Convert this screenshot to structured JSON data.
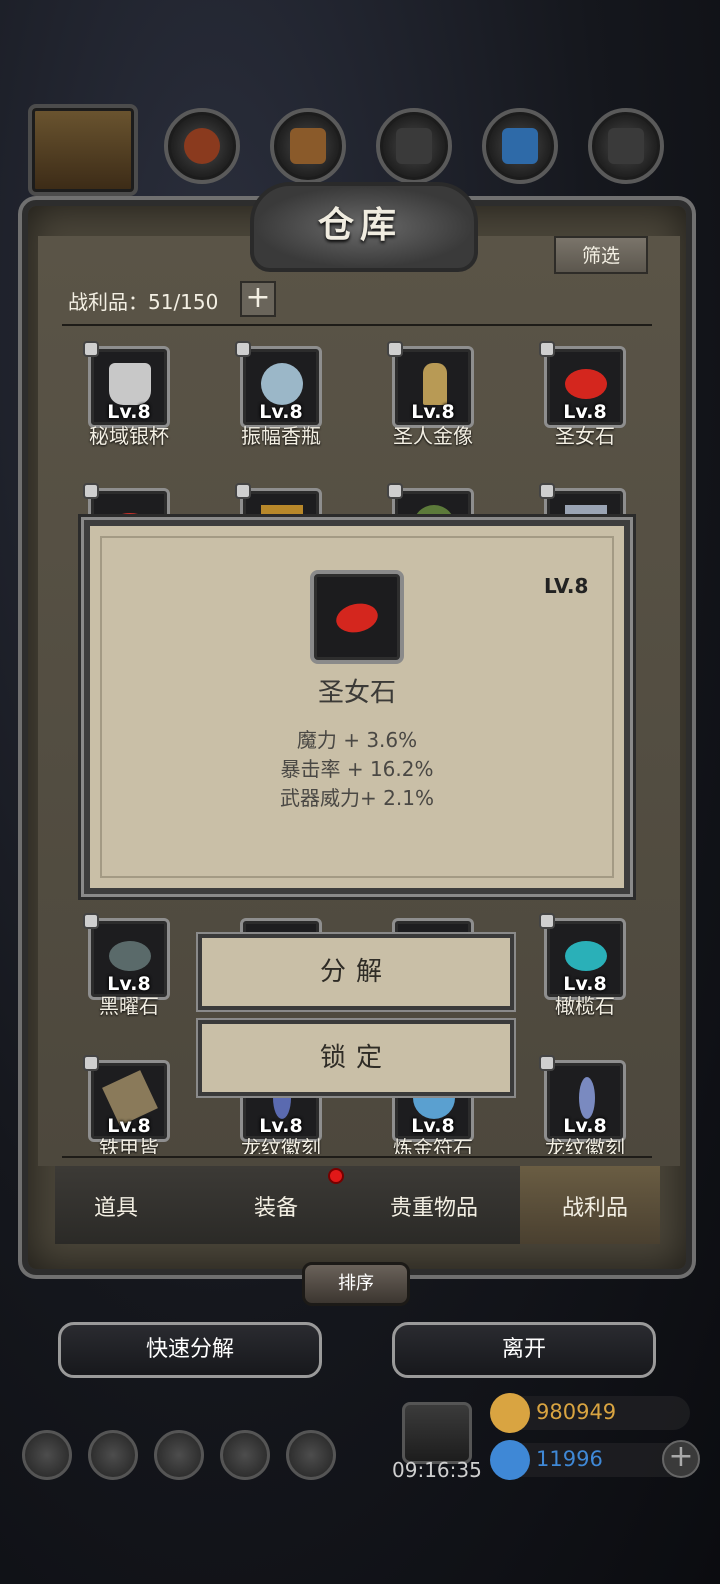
{
  "window": {
    "title": "仓库"
  },
  "header": {
    "filter_label": "筛选",
    "capacity_label": "战利品：51/150",
    "add_label": "+"
  },
  "grid": {
    "rows": [
      [
        {
          "level": "Lv.8",
          "name": "秘域银杯",
          "color": "#c8c8c8"
        },
        {
          "level": "Lv.8",
          "name": "振幅香瓶",
          "color": "#9bb7c8"
        },
        {
          "level": "Lv.8",
          "name": "圣人金像",
          "color": "#b89a55"
        },
        {
          "level": "Lv.8",
          "name": "圣女石",
          "color": "#d4261e"
        }
      ],
      [
        {
          "level": "",
          "name": "",
          "color": "#c8302a"
        },
        {
          "level": "",
          "name": "",
          "color": "#b8882a"
        },
        {
          "level": "",
          "name": "",
          "color": "#5c7a3a"
        },
        {
          "level": "",
          "name": "",
          "color": "#9aa4b4"
        }
      ],
      [
        {
          "level": "Lv.8",
          "name": "黑曜石",
          "color": "#5a6a6a"
        },
        {
          "level": "",
          "name": "",
          "color": "#333"
        },
        {
          "level": "",
          "name": "",
          "color": "#333"
        },
        {
          "level": "Lv.8",
          "name": "橄榄石",
          "color": "#2ab0b8"
        }
      ],
      [
        {
          "level": "Lv.8",
          "name": "铁甲皆",
          "color": "#8a7a5a"
        },
        {
          "level": "Lv.8",
          "name": "龙纹徽刻",
          "color": "#5a6ab0"
        },
        {
          "level": "Lv.8",
          "name": "炼金符石",
          "color": "#5aa0d0"
        },
        {
          "level": "Lv.8",
          "name": "龙纹徽刻",
          "color": "#7a8ac0"
        }
      ]
    ]
  },
  "tabs": [
    "道具",
    "装备",
    "贵重物品",
    "战利品"
  ],
  "sort_label": "排序",
  "buttons": {
    "quick_decompose": "快速分解",
    "leave": "离开"
  },
  "modal": {
    "level": "LV.8",
    "item_name": "圣女石",
    "stats": [
      "魔力 + 3.6%",
      "暴击率 + 16.2%",
      "武器威力+ 2.1%"
    ],
    "decompose": "分解",
    "lock": "锁定"
  },
  "hud": {
    "time": "09:16:35",
    "gold": "980949",
    "gems": "11996",
    "gold_color": "#d9a441",
    "gem_color": "#3f88d6"
  }
}
